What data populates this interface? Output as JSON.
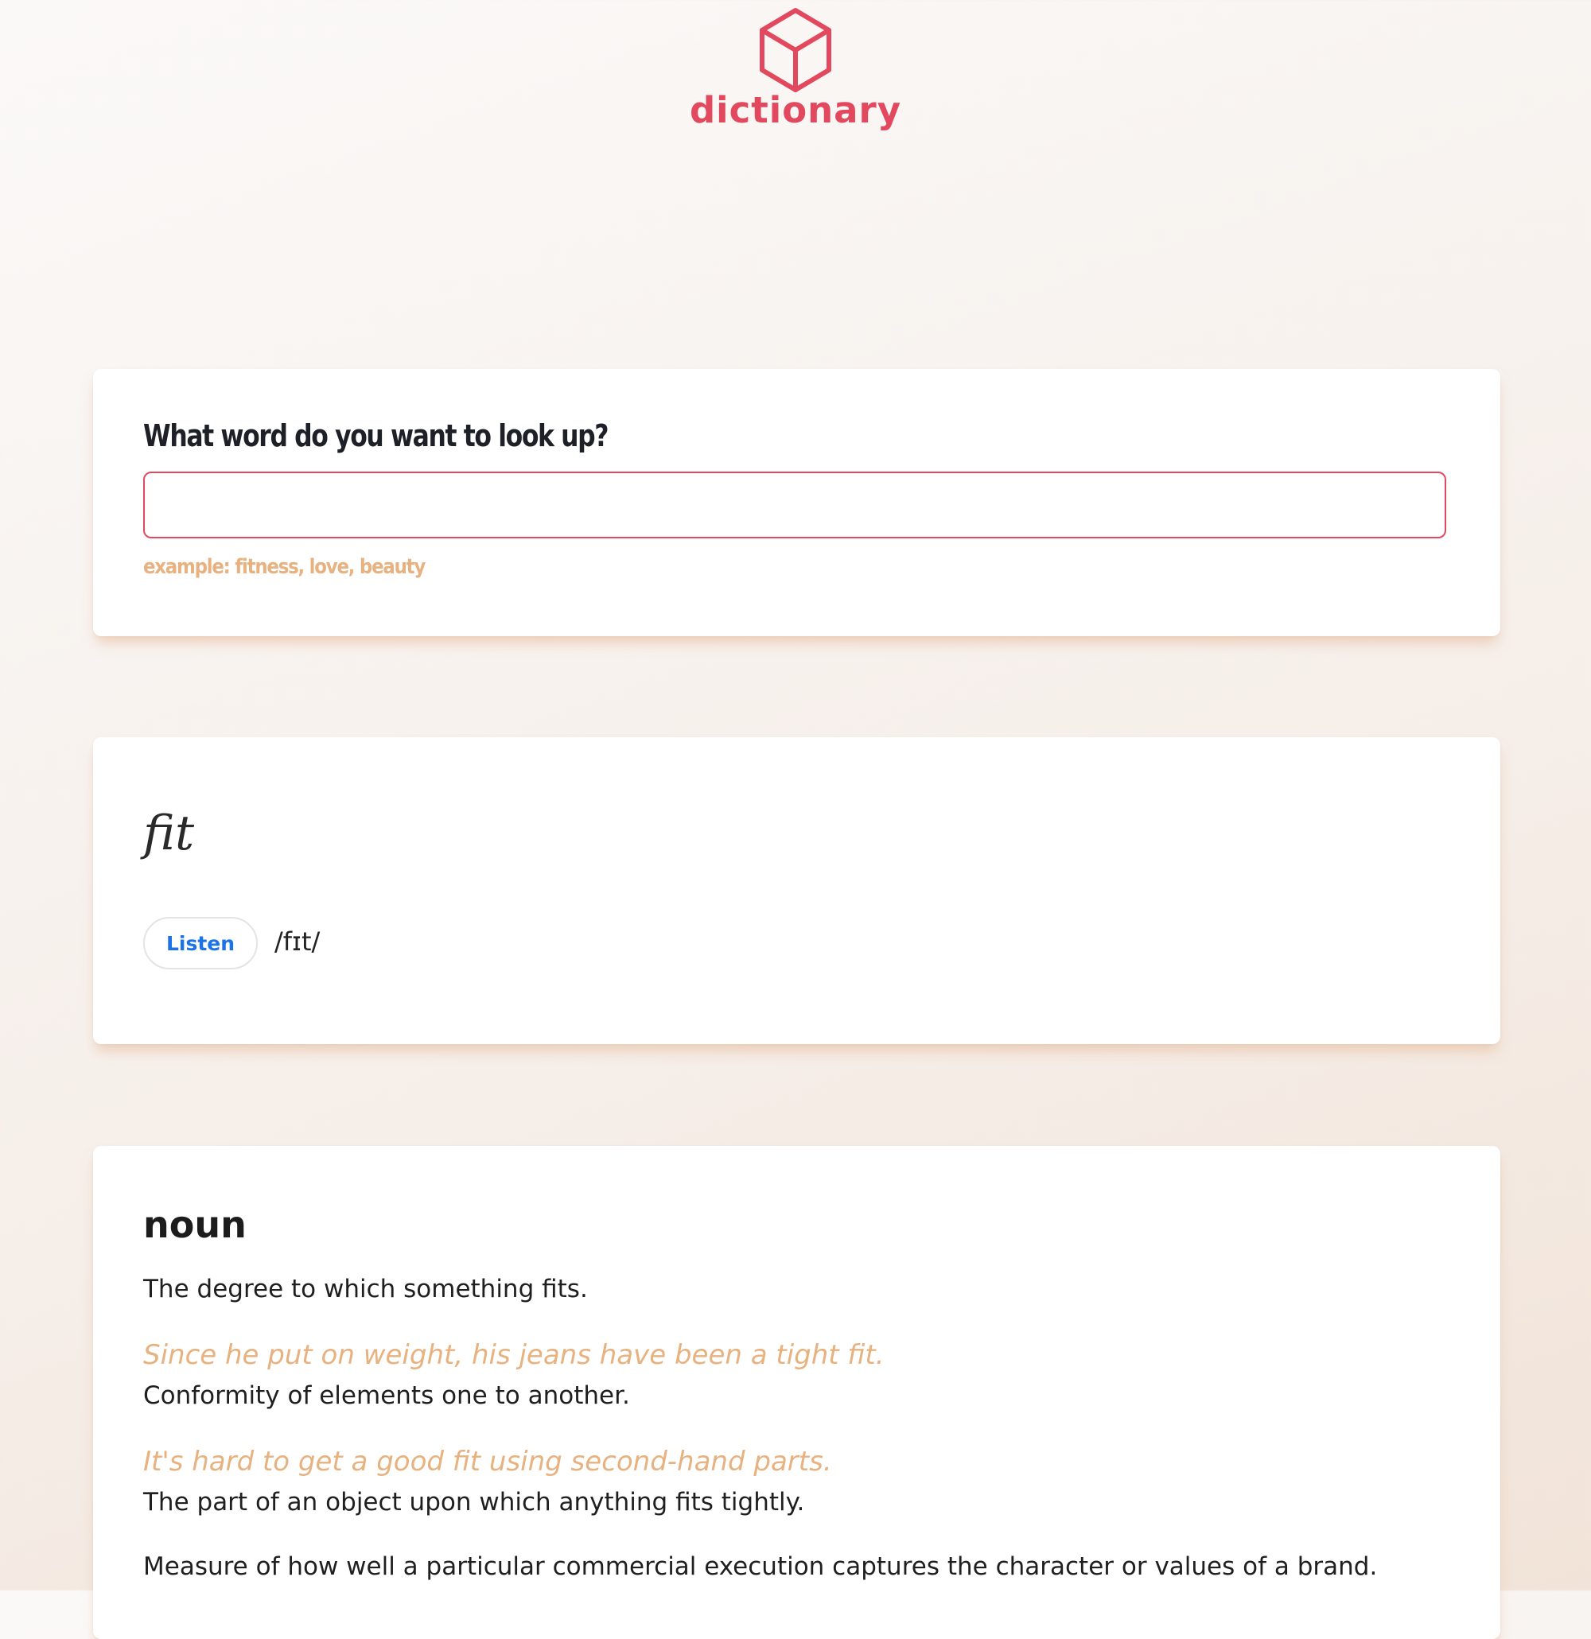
{
  "colors": {
    "brand": "#e2495f",
    "accent_example": "#e7b27f",
    "listen_text": "#1a73e8"
  },
  "header": {
    "logo_icon": "cube-icon",
    "logo_text": "dictionary"
  },
  "search": {
    "label": "What word do you want to look up?",
    "input_value": "",
    "placeholder": "",
    "hint": "example: fitness, love, beauty"
  },
  "word": {
    "headword": "fit",
    "listen_label": "Listen",
    "phonetic": "/fɪt/"
  },
  "meaning": {
    "part_of_speech": "noun",
    "definitions": [
      {
        "text": "The degree to which something fits.",
        "example": "Since he put on weight, his jeans have been a tight fit."
      },
      {
        "text": "Conformity of elements one to another.",
        "example": "It's hard to get a good fit using second-hand parts."
      },
      {
        "text": "The part of an object upon which anything fits tightly.",
        "example": ""
      },
      {
        "text": "Measure of how well a particular commercial execution captures the character or values of a brand.",
        "example": ""
      }
    ]
  }
}
